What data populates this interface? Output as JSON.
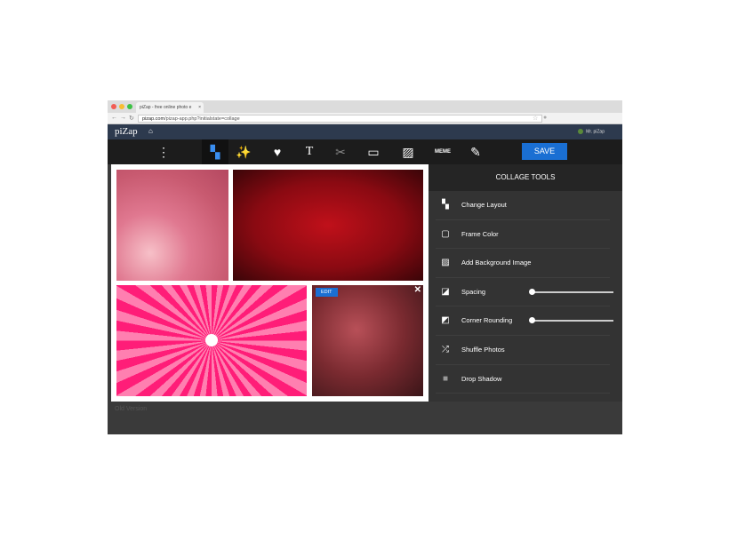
{
  "browser": {
    "tab_title": "piZap - free online photo e",
    "url_host": "pizap.com",
    "url_path": "/pizap-app.php?initialstate=collage"
  },
  "header": {
    "logo": "piZap",
    "user": "Mr. piZap"
  },
  "toolbar": {
    "save_label": "SAVE",
    "meme_label": "MEME"
  },
  "collage": {
    "edit_label": "EDIT",
    "close_label": "✕"
  },
  "panel": {
    "title": "COLLAGE TOOLS",
    "items": [
      {
        "label": "Change Layout",
        "icon": "layout-icon"
      },
      {
        "label": "Frame Color",
        "icon": "frame-color-icon"
      },
      {
        "label": "Add Background Image",
        "icon": "image-icon"
      },
      {
        "label": "Spacing",
        "icon": "spacing-icon",
        "slider": 0
      },
      {
        "label": "Corner Rounding",
        "icon": "corner-icon",
        "slider": 0
      },
      {
        "label": "Shuffle Photos",
        "icon": "shuffle-icon"
      },
      {
        "label": "Drop Shadow",
        "icon": "shadow-icon"
      }
    ]
  },
  "footer": {
    "old_version": "Old Version"
  }
}
